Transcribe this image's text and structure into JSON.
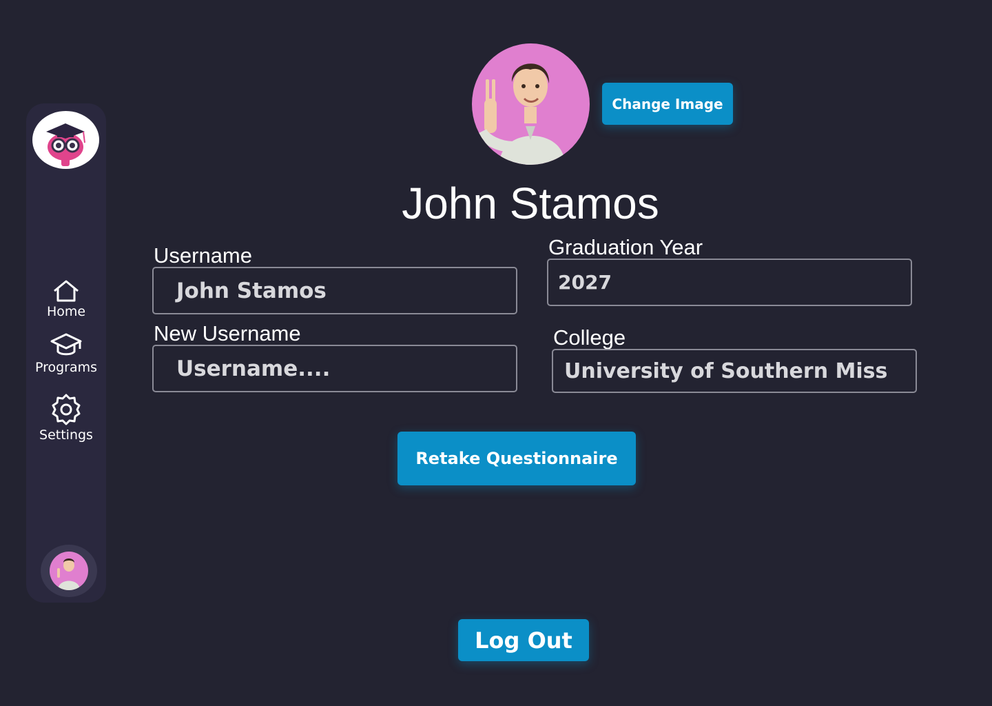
{
  "sidebar": {
    "items": [
      {
        "label": "Home",
        "icon": "home-icon"
      },
      {
        "label": "Programs",
        "icon": "graduation-cap-icon"
      },
      {
        "label": "Settings",
        "icon": "gear-icon"
      }
    ]
  },
  "profile": {
    "name": "John Stamos",
    "change_image_label": "Change Image"
  },
  "fields": {
    "username": {
      "label": "Username",
      "value": "John Stamos"
    },
    "new_username": {
      "label": "New Username",
      "placeholder": "Username...."
    },
    "graduation_year": {
      "label": "Graduation Year",
      "value": "2027"
    },
    "college": {
      "label": "College",
      "value": "University of Southern Miss"
    }
  },
  "actions": {
    "retake_label": "Retake Questionnaire",
    "logout_label": "Log Out"
  },
  "colors": {
    "background": "#232331",
    "sidebar": "#2a283e",
    "accent": "#0b8fc7",
    "avatar_bg": "#e07fcf"
  }
}
